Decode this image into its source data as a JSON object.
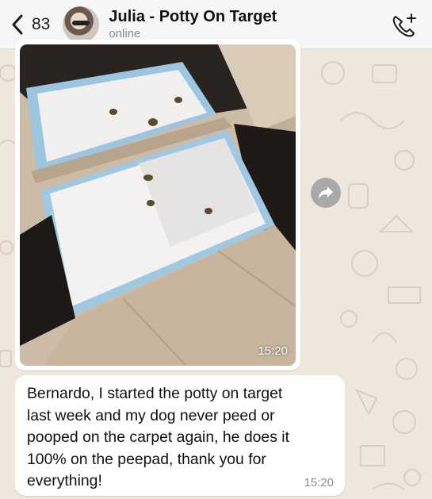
{
  "header": {
    "back_count": "83",
    "contact_name": "Julia - Potty On Target",
    "status": "online"
  },
  "messages": [
    {
      "type": "image",
      "time": "15:20"
    },
    {
      "type": "text",
      "text": "Bernardo, I started the potty on target\nlast week and my dog never peed or\npooped on the carpet again, he does it\n100% on the peepad, thank you for\neverything!",
      "time": "15:20"
    }
  ],
  "icons": [
    "chevron-left-icon",
    "phone-add-icon",
    "forward-icon"
  ],
  "colors": {
    "wallpaper": "#efe7dc",
    "bubble": "#ffffff",
    "header": "#f6f6f6",
    "time": "#8e8e8e"
  }
}
